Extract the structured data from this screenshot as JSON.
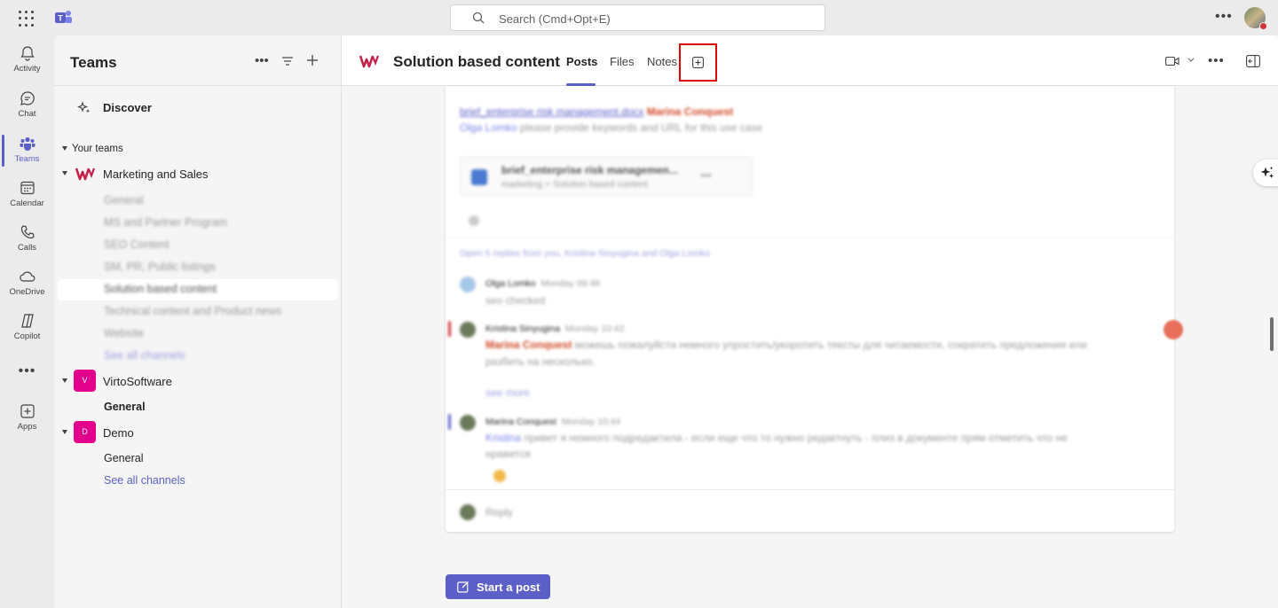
{
  "search": {
    "placeholder": "Search (Cmd+Opt+E)"
  },
  "rail": {
    "items": [
      {
        "label": "Activity",
        "icon": "bell-icon"
      },
      {
        "label": "Chat",
        "icon": "chat-icon"
      },
      {
        "label": "Teams",
        "icon": "teams-icon"
      },
      {
        "label": "Calendar",
        "icon": "calendar-icon"
      },
      {
        "label": "Calls",
        "icon": "phone-icon"
      },
      {
        "label": "OneDrive",
        "icon": "cloud-icon"
      },
      {
        "label": "Copilot",
        "icon": "copilot-icon"
      },
      {
        "label": "Apps",
        "icon": "plus-square-icon"
      }
    ],
    "more": "•••"
  },
  "panel": {
    "title": "Teams",
    "discover": "Discover",
    "section": "Your teams",
    "teams": [
      {
        "name": "Marketing and Sales",
        "channels": [
          "General",
          "MS and Partner Program",
          "SEO Content",
          "SM, PR, Public listings",
          "Solution based content",
          "Technical content and Product news",
          "Website"
        ],
        "see_all": "See all channels"
      },
      {
        "name": "VirtoSoftware",
        "initial": "V",
        "channels": [
          "General"
        ]
      },
      {
        "name": "Demo",
        "initial": "D",
        "channels": [
          "General"
        ],
        "see_all": "See all channels"
      }
    ]
  },
  "header": {
    "title": "Solution based content",
    "tabs": [
      "Posts",
      "Files",
      "Notes"
    ]
  },
  "thread": {
    "link_line": "brief_enterprise risk management.docx",
    "mention_1": "Marina Conquest",
    "line_2_mention": "Olga Lomko",
    "line_2_text": "please provide keywords and URL for this use case",
    "attachment_title": "brief_enterprise risk managemen...",
    "attachment_sub": "marketing > Solution based content",
    "replies_link": "Open 5 replies from you, Kristina Sinyugina and Olga Lomko",
    "msg1_author": "Olga Lomko",
    "msg1_time": "Monday 09:48",
    "msg1_text": "seo checked",
    "msg2_author": "Kristina Sinyugina",
    "msg2_time": "Monday 10:42",
    "msg2_mention": "Marina Conquest",
    "msg2_text": "можешь пожалуйста немного упростить/укоротить тексты для читаемости, сократить предложения или",
    "msg2_text2": "разбить на несколько.",
    "msg2_more": "see more",
    "msg3_author": "Marina Conquest",
    "msg3_time": "Monday 10:44",
    "msg3_mention": "Kristina",
    "msg3_text": "привет я немного подредактила - если еще что то нужно редактнуть - плиз в документе прям отметить что не",
    "msg3_text2": "нравится",
    "reply_label": "Reply"
  },
  "start_post": "Start a post",
  "colors": {
    "accent": "#5b5fc7",
    "highlight": "#e00000",
    "mention": "#d24726"
  }
}
